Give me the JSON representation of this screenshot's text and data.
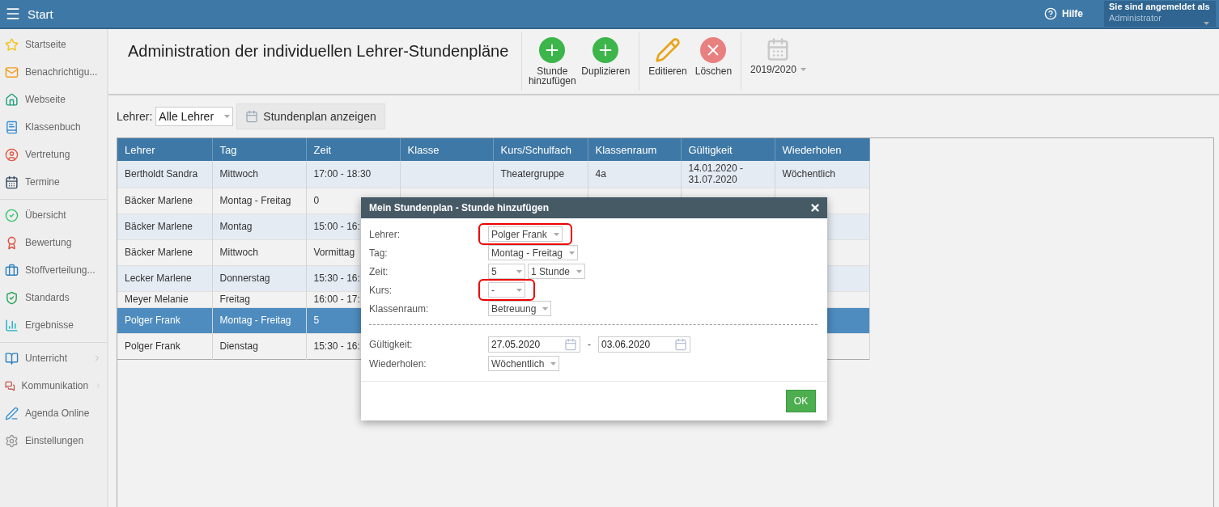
{
  "top_bar": {
    "title": "Start",
    "help": "Hilfe",
    "login_label": "Sie sind angemeldet als",
    "user": "Administrator"
  },
  "sidebar": {
    "groups": [
      [
        {
          "label": "Startseite",
          "has_submenu": false
        },
        {
          "label": "Benachrichtigu...",
          "has_submenu": false
        },
        {
          "label": "Webseite",
          "has_submenu": false
        },
        {
          "label": "Klassenbuch",
          "has_submenu": false
        },
        {
          "label": "Vertretung",
          "has_submenu": false
        },
        {
          "label": "Termine",
          "has_submenu": false
        }
      ],
      [
        {
          "label": "Übersicht",
          "has_submenu": false
        },
        {
          "label": "Bewertung",
          "has_submenu": false
        },
        {
          "label": "Stoffverteilung...",
          "has_submenu": false
        },
        {
          "label": "Standards",
          "has_submenu": false
        },
        {
          "label": "Ergebnisse",
          "has_submenu": false
        }
      ],
      [
        {
          "label": "Unterricht",
          "has_submenu": true
        },
        {
          "label": "Kommunikation",
          "has_submenu": true
        },
        {
          "label": "Agenda Online",
          "has_submenu": false
        },
        {
          "label": "Einstellungen",
          "has_submenu": false
        }
      ]
    ]
  },
  "page_title": "Administration der individuellen Lehrer-Stundenpläne",
  "toolbar": {
    "groups": [
      [
        {
          "label": "Stunde hinzufügen"
        },
        {
          "label": "Duplizieren"
        }
      ],
      [
        {
          "label": "Editieren"
        },
        {
          "label": "Löschen"
        }
      ]
    ],
    "year": "2019/2020"
  },
  "filter": {
    "label": "Lehrer:",
    "value": "Alle Lehrer",
    "button": "Stundenplan anzeigen"
  },
  "table": {
    "columns": [
      "Lehrer",
      "Tag",
      "Zeit",
      "Klasse",
      "Kurs/Schulfach",
      "Klassenraum",
      "Gültigkeit",
      "Wiederholen"
    ],
    "rows": [
      {
        "selected": false,
        "cells": [
          "Bertholdt Sandra",
          "Mittwoch",
          "17:00 - 18:30",
          "",
          "Theatergruppe",
          "4a",
          "14.01.2020 - 31.07.2020",
          "Wöchentlich"
        ]
      },
      {
        "selected": false,
        "cells": [
          "Bäcker Marlene",
          "Montag - Freitag",
          "0"
        ]
      },
      {
        "selected": false,
        "cells": [
          "Bäcker Marlene",
          "Montag",
          "15:00 - 16:"
        ]
      },
      {
        "selected": false,
        "cells": [
          "Bäcker Marlene",
          "Mittwoch",
          "Vormittag"
        ]
      },
      {
        "selected": false,
        "cells": [
          "Lecker Marlene",
          "Donnerstag",
          "15:30 - 16:"
        ]
      },
      {
        "selected": false,
        "cells": [
          "Meyer Melanie",
          "Freitag",
          "16:00 - 17:"
        ]
      },
      {
        "selected": true,
        "cells": [
          "Polger Frank",
          "Montag - Freitag",
          "5"
        ]
      },
      {
        "selected": false,
        "cells": [
          "Polger Frank",
          "Dienstag",
          "15:30 - 16:"
        ]
      }
    ]
  },
  "dialog": {
    "title": "Mein Stundenplan - Stunde hinzufügen",
    "fields": [
      {
        "label": "Lehrer:",
        "kind": "select",
        "values": [
          "Polger Frank"
        ],
        "highlighted": true
      },
      {
        "label": "Tag:",
        "kind": "select",
        "values": [
          "Montag - Freitag"
        ],
        "highlighted": false
      },
      {
        "label": "Zeit:",
        "kind": "select",
        "values": [
          "5",
          "1 Stunde"
        ],
        "highlighted": false
      },
      {
        "label": "Kurs:",
        "kind": "select",
        "values": [
          "-"
        ],
        "highlighted": true
      },
      {
        "label": "Klassenraum:",
        "kind": "select",
        "values": [
          "Betreuung"
        ],
        "highlighted": false
      }
    ],
    "fields_2": [
      {
        "label": "Gültigkeit:",
        "kind": "daterange",
        "values": [
          "27.05.2020",
          "03.06.2020"
        ],
        "separator": "-",
        "highlighted": false
      },
      {
        "label": "Wiederholen:",
        "kind": "select",
        "values": [
          "Wöchentlich"
        ],
        "highlighted": false
      }
    ],
    "ok": "OK"
  }
}
